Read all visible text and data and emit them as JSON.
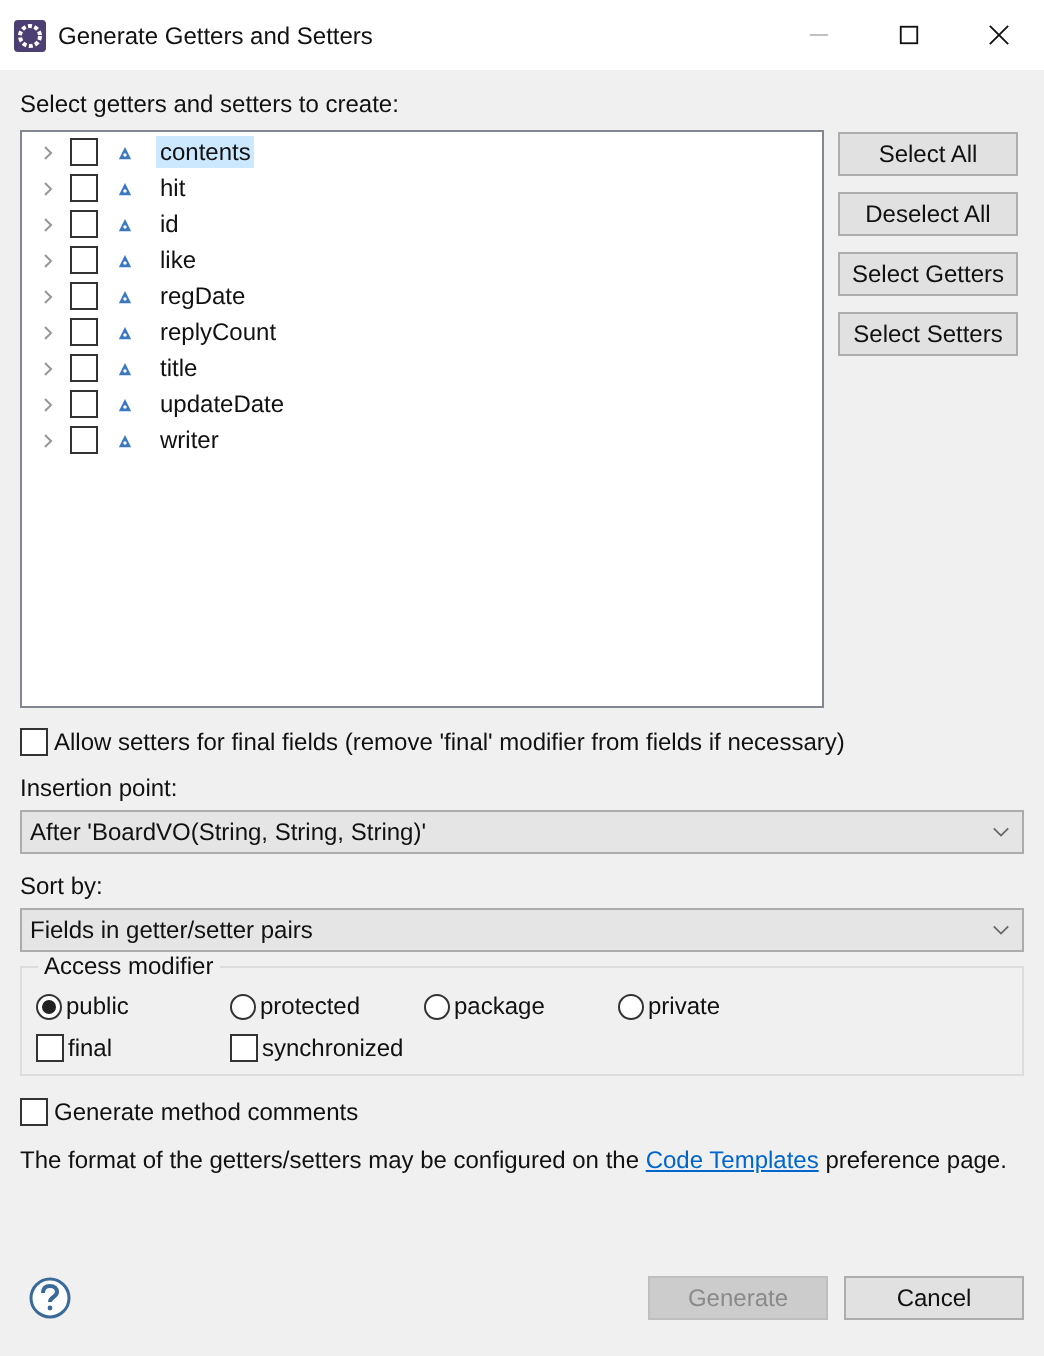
{
  "window": {
    "title": "Generate Getters and Setters"
  },
  "fields_label": "Select getters and setters to create:",
  "fields": [
    {
      "name": "contents",
      "checked": false,
      "selected": true,
      "expanded": false
    },
    {
      "name": "hit",
      "checked": false,
      "selected": false,
      "expanded": false
    },
    {
      "name": "id",
      "checked": false,
      "selected": false,
      "expanded": false
    },
    {
      "name": "like",
      "checked": false,
      "selected": false,
      "expanded": false
    },
    {
      "name": "regDate",
      "checked": false,
      "selected": false,
      "expanded": false
    },
    {
      "name": "replyCount",
      "checked": false,
      "selected": false,
      "expanded": false
    },
    {
      "name": "title",
      "checked": false,
      "selected": false,
      "expanded": false
    },
    {
      "name": "updateDate",
      "checked": false,
      "selected": false,
      "expanded": false
    },
    {
      "name": "writer",
      "checked": false,
      "selected": false,
      "expanded": false
    }
  ],
  "side_buttons": [
    "Select All",
    "Deselect All",
    "Select Getters",
    "Select Setters"
  ],
  "allow_final": {
    "label": "Allow setters for final fields (remove 'final' modifier from fields if necessary)",
    "checked": false
  },
  "insertion_point": {
    "label": "Insertion point:",
    "value": "After 'BoardVO(String, String, String)'"
  },
  "sort_by": {
    "label": "Sort by:",
    "value": "Fields in getter/setter pairs"
  },
  "access_modifier": {
    "title": "Access modifier",
    "options": [
      {
        "label": "public",
        "selected": true
      },
      {
        "label": "protected",
        "selected": false
      },
      {
        "label": "package",
        "selected": false
      },
      {
        "label": "private",
        "selected": false
      }
    ],
    "flags": [
      {
        "label": "final",
        "checked": false
      },
      {
        "label": "synchronized",
        "checked": false
      }
    ]
  },
  "generate_comments": {
    "label": "Generate method comments",
    "checked": false
  },
  "note": {
    "before": "The format of the getters/setters may be configured on the",
    "link": "Code Templates",
    "after": "preference page."
  },
  "footer_buttons": [
    {
      "label": "Generate",
      "disabled": true
    },
    {
      "label": "Cancel",
      "disabled": false
    }
  ]
}
